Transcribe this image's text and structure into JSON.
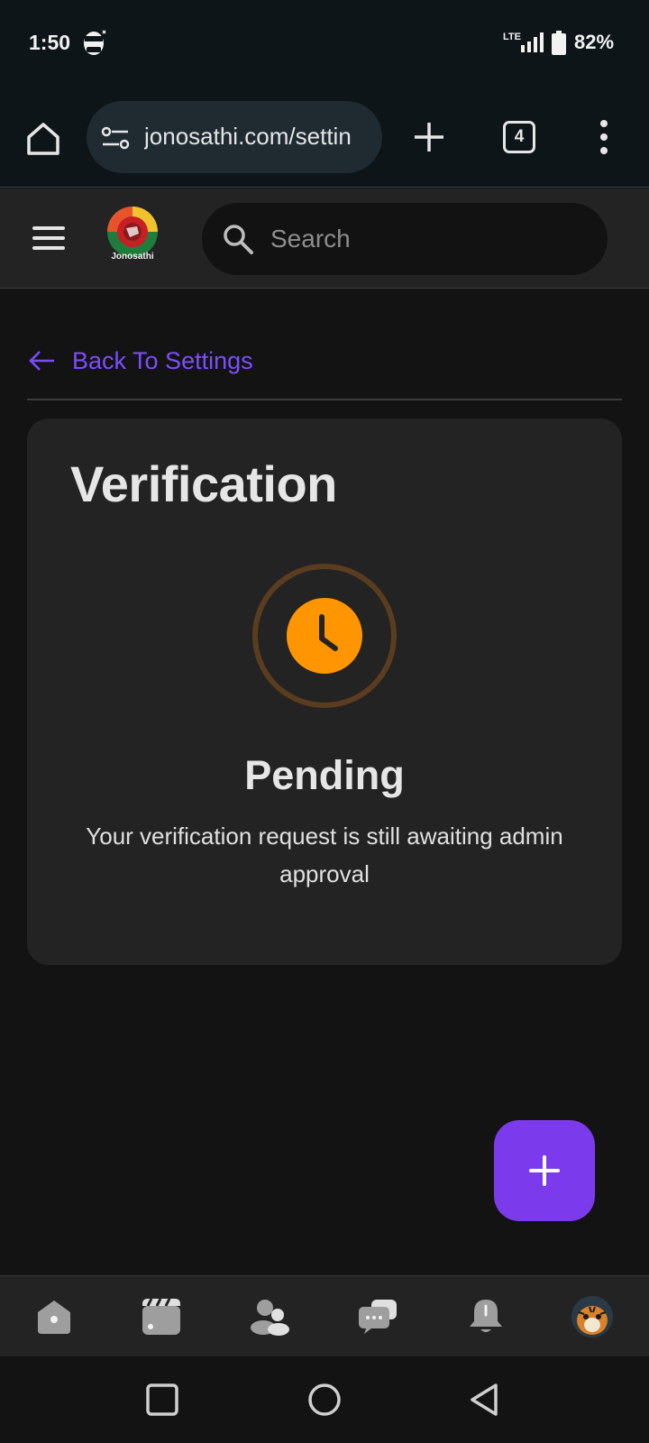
{
  "status_bar": {
    "time": "1:50",
    "network": "LTE",
    "battery": "82%"
  },
  "browser": {
    "url": "jonosathi.com/settin",
    "tab_count": "4",
    "icons": [
      "home-icon",
      "tune-icon",
      "plus-icon",
      "tabs-icon",
      "more-vert-icon"
    ]
  },
  "site_header": {
    "logo_text": "Jonosathi",
    "search_placeholder": "Search"
  },
  "back_link": {
    "label": "Back To Settings"
  },
  "verification": {
    "title": "Verification",
    "status": "Pending",
    "message": "Your verification request is still awaiting admin approval",
    "status_color": "#ff9500"
  },
  "fab": {
    "icon": "plus-icon"
  },
  "bottom_nav": {
    "items": [
      "home-icon",
      "reels-icon",
      "friends-icon",
      "messages-icon",
      "notifications-icon",
      "profile-avatar"
    ]
  },
  "colors": {
    "accent": "#7c3aed",
    "link": "#7c4dff",
    "pending": "#ff9500"
  }
}
